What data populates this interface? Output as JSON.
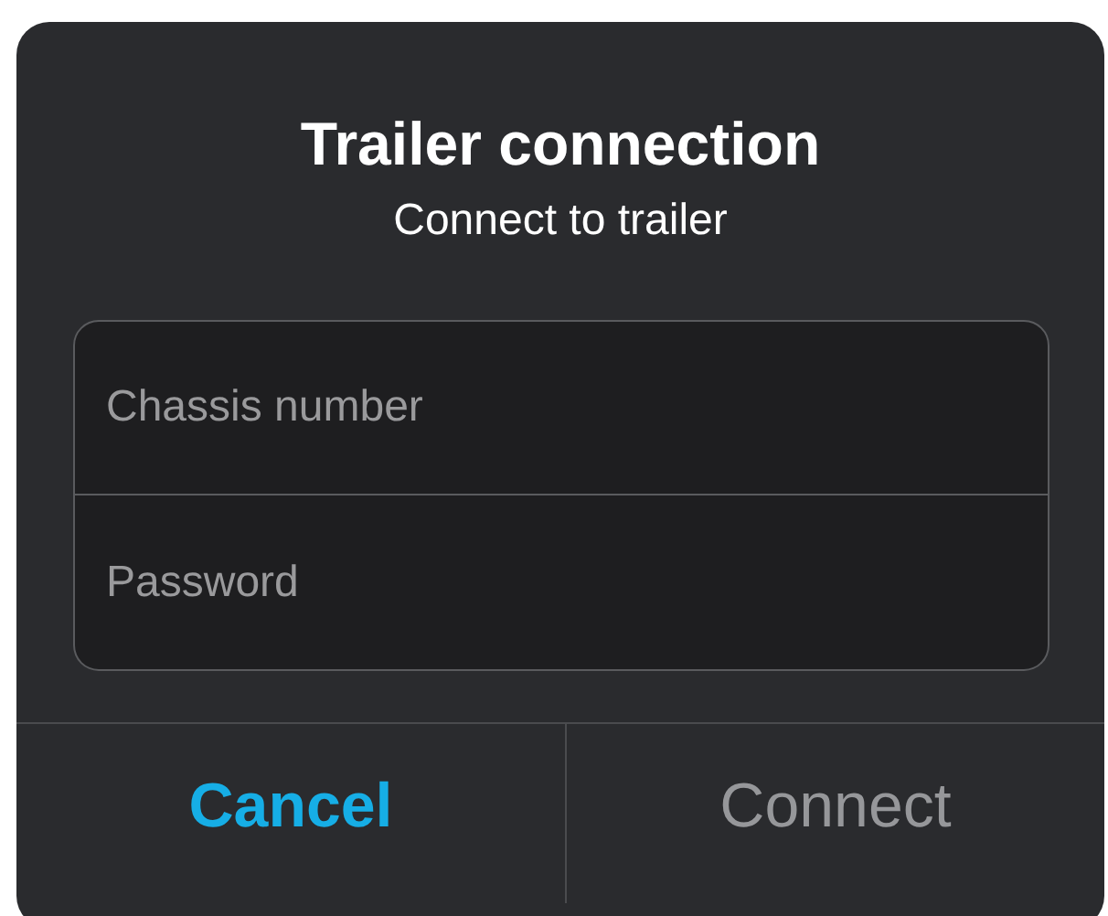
{
  "dialog": {
    "title": "Trailer connection",
    "message": "Connect to trailer"
  },
  "fields": [
    {
      "placeholder": "Chassis number"
    },
    {
      "placeholder": "Password"
    }
  ],
  "buttons": [
    {
      "label": "Cancel",
      "kind": "cancel",
      "disabled": false
    },
    {
      "label": "Connect",
      "kind": "default",
      "disabled": true
    }
  ]
}
